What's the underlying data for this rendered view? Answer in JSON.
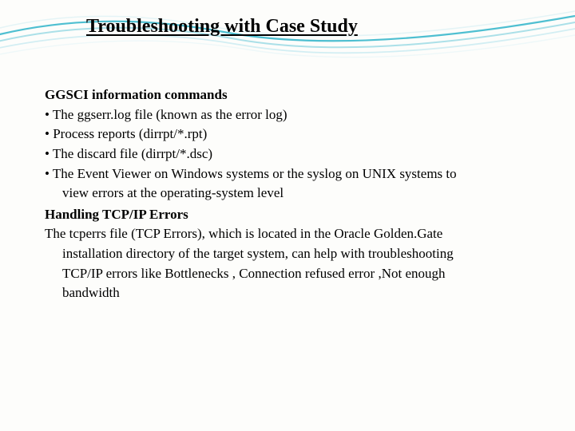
{
  "title": "Troubleshooting with Case Study",
  "section1": {
    "heading": "GGSCI information commands",
    "b1": "• The ggserr.log file (known as the error log)",
    "b2": "• Process reports (dirrpt/*.rpt)",
    "b3": "• The discard file (dirrpt/*.dsc)",
    "b4a": "• The Event Viewer on Windows systems or the syslog on UNIX systems to",
    "b4b": "view errors at the operating-system level"
  },
  "section2": {
    "heading": "Handling TCP/IP Errors",
    "p1": "The tcperrs file (TCP Errors), which is located in the Oracle Golden.Gate",
    "p2": "installation directory of the target system, can help with troubleshooting",
    "p3": "TCP/IP errors like  Bottlenecks , Connection refused error ,Not enough",
    "p4": "bandwidth"
  }
}
